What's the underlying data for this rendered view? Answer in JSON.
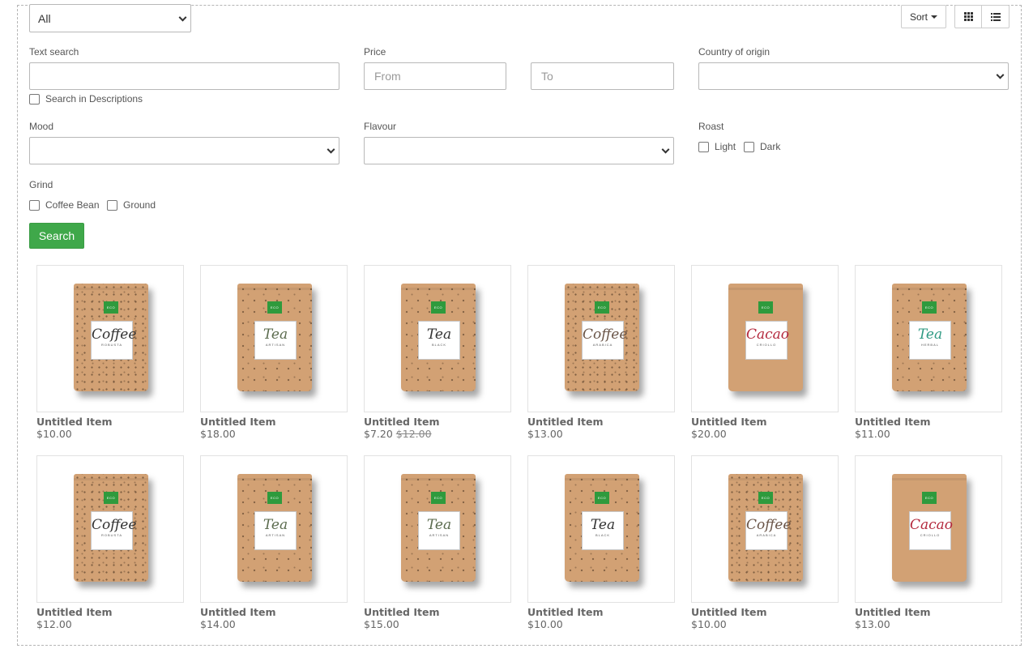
{
  "toolbar": {
    "category_select": "All",
    "sort_label": "Sort"
  },
  "filters": {
    "text_search_label": "Text search",
    "text_search_value": "",
    "search_descriptions_label": "Search in Descriptions",
    "price_label": "Price",
    "price_from_placeholder": "From",
    "price_to_placeholder": "To",
    "country_label": "Country of origin",
    "country_value": "",
    "mood_label": "Mood",
    "mood_value": "",
    "flavour_label": "Flavour",
    "flavour_value": "",
    "roast_label": "Roast",
    "roast_options": [
      "Light",
      "Dark"
    ],
    "grind_label": "Grind",
    "grind_options": [
      "Coffee Bean",
      "Ground"
    ],
    "search_button": "Search"
  },
  "products": [
    {
      "name": "Untitled Item",
      "price": "$10.00",
      "old_price": "",
      "kind": "Coffee",
      "variant": "ROBUSTA",
      "pattern": "dense",
      "label_color": "#333333"
    },
    {
      "name": "Untitled Item",
      "price": "$18.00",
      "old_price": "",
      "kind": "Tea",
      "variant": "ARTISAN",
      "pattern": "sparse",
      "label_color": "#5b6b4e"
    },
    {
      "name": "Untitled Item",
      "price": "$7.20",
      "old_price": "$12.00",
      "kind": "Tea",
      "variant": "BLACK",
      "pattern": "sparse",
      "label_color": "#333333"
    },
    {
      "name": "Untitled Item",
      "price": "$13.00",
      "old_price": "",
      "kind": "Coffee",
      "variant": "ARABICA",
      "pattern": "dense",
      "label_color": "#6a5548"
    },
    {
      "name": "Untitled Item",
      "price": "$20.00",
      "old_price": "",
      "kind": "Cacao",
      "variant": "CRIOLLO",
      "pattern": "plain",
      "label_color": "#b3283c"
    },
    {
      "name": "Untitled Item",
      "price": "$11.00",
      "old_price": "",
      "kind": "Tea",
      "variant": "HERBAL",
      "pattern": "sparse",
      "label_color": "#2f9a83"
    },
    {
      "name": "Untitled Item",
      "price": "$12.00",
      "old_price": "",
      "kind": "Coffee",
      "variant": "ROBUSTA",
      "pattern": "dense",
      "label_color": "#333333"
    },
    {
      "name": "Untitled Item",
      "price": "$14.00",
      "old_price": "",
      "kind": "Tea",
      "variant": "ARTISAN",
      "pattern": "sparse",
      "label_color": "#5b6b4e"
    },
    {
      "name": "Untitled Item",
      "price": "$15.00",
      "old_price": "",
      "kind": "Tea",
      "variant": "ARTISAN",
      "pattern": "sparse",
      "label_color": "#5b6b4e"
    },
    {
      "name": "Untitled Item",
      "price": "$10.00",
      "old_price": "",
      "kind": "Tea",
      "variant": "BLACK",
      "pattern": "sparse",
      "label_color": "#333333"
    },
    {
      "name": "Untitled Item",
      "price": "$10.00",
      "old_price": "",
      "kind": "Coffee",
      "variant": "ARABICA",
      "pattern": "dense",
      "label_color": "#6a5548"
    },
    {
      "name": "Untitled Item",
      "price": "$13.00",
      "old_price": "",
      "kind": "Cacao",
      "variant": "CRIOLLO",
      "pattern": "plain",
      "label_color": "#b3283c"
    }
  ],
  "colors": {
    "search_button": "#3fa84a",
    "eco_badge": "#2f9a3d",
    "bag_kraft": "#d2a174"
  },
  "icons": {
    "grid_view": "grid-icon",
    "list_view": "list-icon",
    "dropdown": "chevron-down-icon"
  }
}
